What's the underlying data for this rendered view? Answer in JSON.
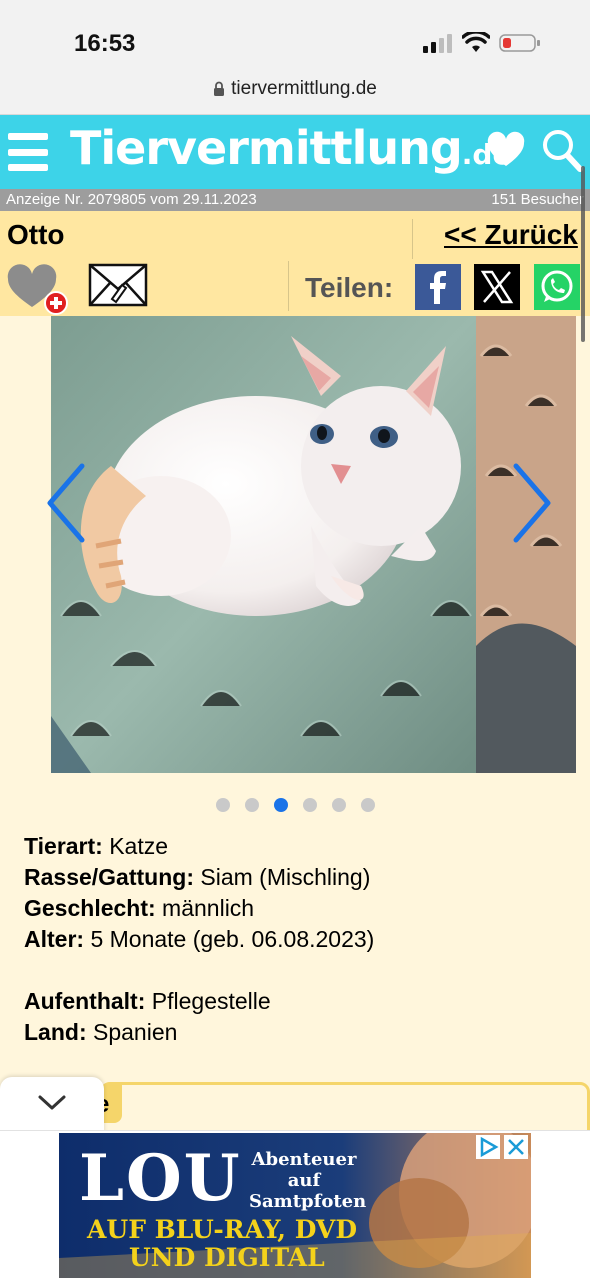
{
  "status_bar": {
    "time": "16:53",
    "url": "tiervermittlung.de",
    "icons": [
      "signal-icon",
      "wifi-icon",
      "battery-low-icon",
      "lock-icon"
    ]
  },
  "header": {
    "brand_main": "Tiervermittlung",
    "brand_tld": ".de",
    "icons": [
      "menu-icon",
      "heart-icon",
      "search-icon"
    ],
    "accent_color": "#3dd3e8"
  },
  "info_strip": {
    "ad_info": "Anzeige Nr. 2079805 vom 29.11.2023",
    "visitors": "151 Besucher"
  },
  "listing": {
    "name": "Otto",
    "back_label": "<< Zurück",
    "share_label": "Teilen:",
    "share_targets": [
      "facebook-icon",
      "x-icon",
      "whatsapp-icon"
    ]
  },
  "gallery": {
    "slide_count": 6,
    "active_index": 2
  },
  "details": {
    "tierart_label": "Tierart:",
    "tierart_value": "Katze",
    "rasse_label": "Rasse/Gattung:",
    "rasse_value": "Siam (Mischling)",
    "geschlecht_label": "Geschlecht:",
    "geschlecht_value": "männlich",
    "alter_label": "Alter:",
    "alter_value": "5 Monate (geb. 06.08.2023)",
    "aufenthalt_label": "Aufenthalt:",
    "aufenthalt_value": "Pflegestelle",
    "land_label": "Land:",
    "land_value": "Spanien"
  },
  "panel": {
    "tab_fragment": "e"
  },
  "ad": {
    "logo": "LOU",
    "tagline": "Abenteuer auf Samtpfoten",
    "line1": "AUF BLU-RAY, DVD",
    "line2": "UND DIGITAL"
  }
}
